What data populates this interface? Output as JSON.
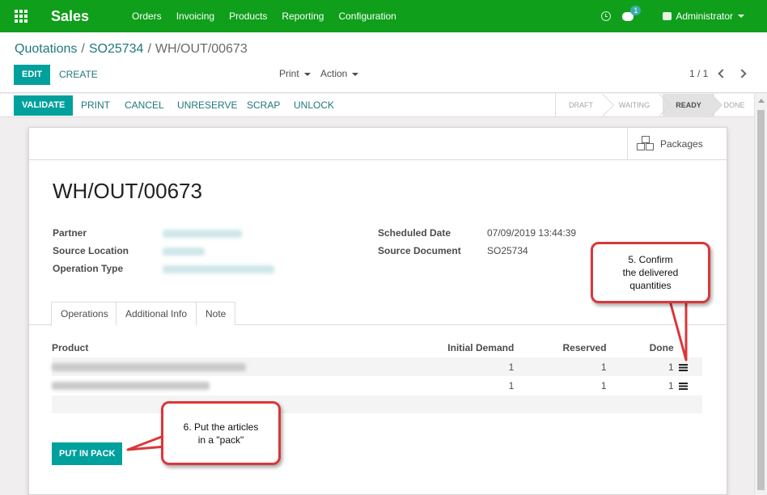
{
  "navbar": {
    "brand": "Sales",
    "menu": [
      "Orders",
      "Invoicing",
      "Products",
      "Reporting",
      "Configuration"
    ],
    "chat_badge": "1",
    "user": "Administrator",
    "color": "#0f9f1b"
  },
  "breadcrumb": {
    "items": [
      "Quotations",
      "SO25734"
    ],
    "current": "WH/OUT/00673"
  },
  "control": {
    "edit": "EDIT",
    "create": "CREATE",
    "print": "Print",
    "action": "Action",
    "pager": "1 / 1"
  },
  "statusbar": {
    "validate": "VALIDATE",
    "print": "PRINT",
    "cancel": "CANCEL",
    "unreserve": "UNRESERVE",
    "scrap": "SCRAP",
    "unlock": "UNLOCK",
    "stages": [
      "DRAFT",
      "WAITING",
      "READY",
      "DONE"
    ],
    "active_stage": "READY"
  },
  "form": {
    "packages": "Packages",
    "title": "WH/OUT/00673",
    "labels": {
      "partner": "Partner",
      "source_location": "Source Location",
      "operation_type": "Operation Type",
      "scheduled_date": "Scheduled Date",
      "source_document": "Source Document"
    },
    "values": {
      "scheduled_date": "07/09/2019 13:44:39",
      "source_document": "SO25734"
    },
    "tabs": [
      "Operations",
      "Additional Info",
      "Note"
    ],
    "active_tab": "Operations",
    "columns": [
      "Product",
      "Initial Demand",
      "Reserved",
      "Done"
    ],
    "rows": [
      {
        "initial": "1",
        "reserved": "1",
        "done": "1"
      },
      {
        "initial": "1",
        "reserved": "1",
        "done": "1"
      }
    ],
    "put_in_pack": "PUT IN PACK"
  },
  "callouts": {
    "confirm": [
      "5. Confirm",
      "the delivered",
      "quantities"
    ],
    "pack": [
      "6. Put the articles",
      "in a \"pack\""
    ]
  },
  "colors": {
    "primary": "#00a09d",
    "link": "#21777a",
    "callout_border": "#d9383a"
  }
}
